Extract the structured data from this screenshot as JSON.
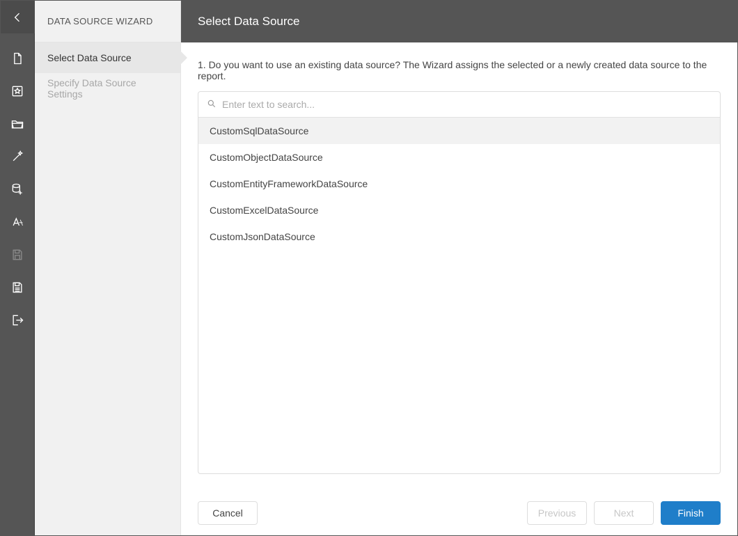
{
  "sidebar": {
    "title": "DATA SOURCE WIZARD",
    "items": [
      {
        "label": "Select Data Source",
        "active": true
      },
      {
        "label": "Specify Data Source Settings",
        "active": false
      }
    ]
  },
  "header": {
    "title": "Select Data Source"
  },
  "prompt": "1. Do you want to use an existing data source? The Wizard assigns the selected or a newly created data source to the report.",
  "search": {
    "placeholder": "Enter text to search...",
    "value": ""
  },
  "dataSources": [
    {
      "label": "CustomSqlDataSource",
      "selected": true
    },
    {
      "label": "CustomObjectDataSource",
      "selected": false
    },
    {
      "label": "CustomEntityFrameworkDataSource",
      "selected": false
    },
    {
      "label": "CustomExcelDataSource",
      "selected": false
    },
    {
      "label": "CustomJsonDataSource",
      "selected": false
    }
  ],
  "footer": {
    "cancel": "Cancel",
    "previous": "Previous",
    "next": "Next",
    "finish": "Finish"
  },
  "rail": {
    "icons": [
      "back-icon",
      "new-icon",
      "wizard-icon",
      "open-icon",
      "magic-icon",
      "data-icon",
      "text-icon",
      "save-icon",
      "save-as-icon",
      "exit-icon"
    ]
  }
}
